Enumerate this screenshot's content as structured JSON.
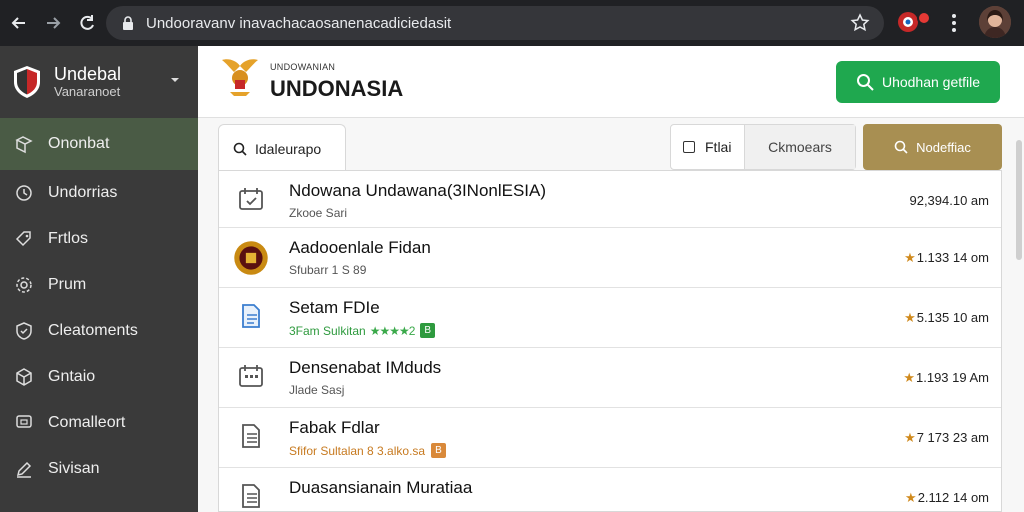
{
  "browser": {
    "url": "Undooravanv inavachacaosanenacadiciedasit"
  },
  "sidebar": {
    "brand_title": "Undebal",
    "brand_subtitle": "Vanaranoet",
    "items": [
      {
        "label": "Ononbat",
        "icon": "bookmark-icon",
        "active": true
      },
      {
        "label": "Undorrias",
        "icon": "clock-icon"
      },
      {
        "label": "Frtlos",
        "icon": "tag-icon"
      },
      {
        "label": "Prum",
        "icon": "gear-icon"
      },
      {
        "label": "Cleatoments",
        "icon": "shield-icon"
      },
      {
        "label": "Gntaio",
        "icon": "cube-icon"
      },
      {
        "label": "Comalleort",
        "icon": "monitor-icon"
      },
      {
        "label": "Sivisan",
        "icon": "pencil-icon"
      }
    ]
  },
  "header": {
    "small_text": "UNDOWANIAN",
    "title": "UNDONASIA",
    "cta_label": "Uhodhan getfile"
  },
  "toolbar": {
    "search_tab": "Idaleurapo",
    "filter_label": "Ftlai",
    "filter_option": "Ckmoears",
    "gold_button": "Nodeffiac"
  },
  "rows": [
    {
      "title": "Ndowana Undawana(3INonlESIA)",
      "sub": "Zkooe Sari",
      "right": "92,394.10 am",
      "icon": "calendar-check-icon",
      "style": "plain"
    },
    {
      "title": "Aadooenlale Fidan",
      "sub": "Sfubarr 1 S 89",
      "right": "1.133 14 om",
      "icon": "emblem-icon",
      "style": "plain",
      "star": true
    },
    {
      "title": "Setam FDIe",
      "sub": "3Fam Sulkitan",
      "stars": "★★★★2",
      "badge": "B",
      "right": "5.135 10 am",
      "icon": "document-icon",
      "style": "green",
      "star": true
    },
    {
      "title": "Densenabat IMduds",
      "sub": "Jlade Sasj",
      "right": "1.193 19 Am",
      "icon": "calendar-grid-icon",
      "style": "plain",
      "star": true
    },
    {
      "title": "Fabak Fdlar",
      "sub": "Sfifor Sultalan 8 3.alko.sa",
      "badge": "B",
      "right": "7 173 23 am",
      "icon": "file-text-icon",
      "style": "orange",
      "star": true
    },
    {
      "title": "Duasansianain Muratiaa",
      "sub": "",
      "right": "2.112 14 om",
      "icon": "file-text-icon",
      "style": "green",
      "star": true
    }
  ],
  "colors": {
    "accent_green": "#1fa84f",
    "gold": "#a88f52",
    "sidebar_bg": "#3a3a3a",
    "sidebar_active": "#4a5b45"
  }
}
